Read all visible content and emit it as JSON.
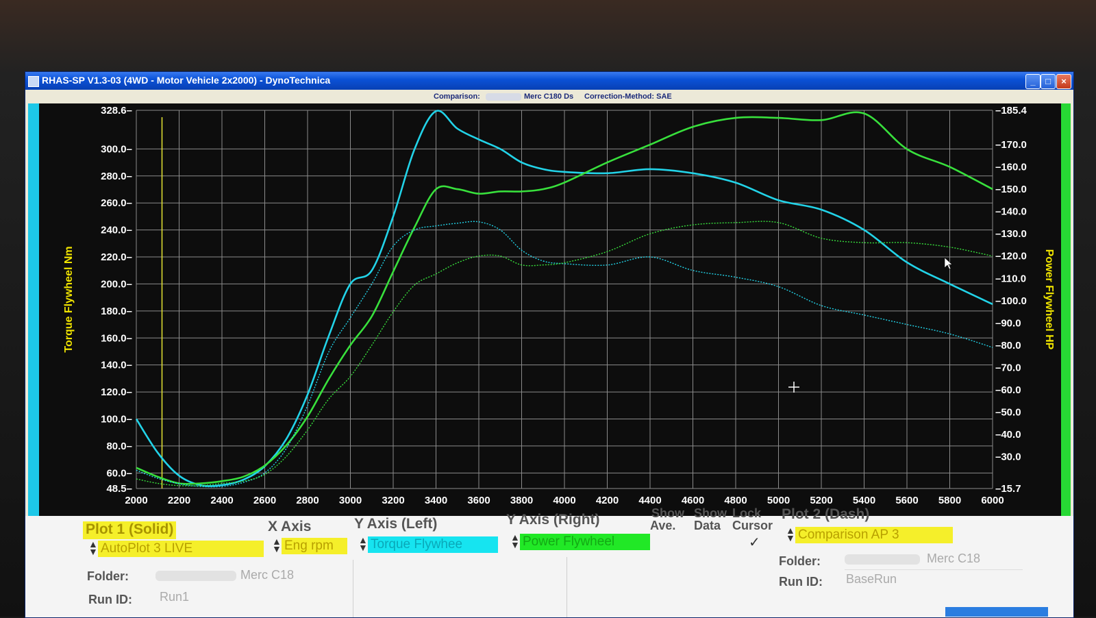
{
  "window": {
    "title": "RHAS-SP V1.3-03  (4WD - Motor Vehicle 2x2000) - DynoTechnica",
    "buttons": {
      "minimize": "_",
      "maximize": "□",
      "close": "×"
    }
  },
  "info_bar": {
    "comparison_label": "Comparison:",
    "vehicle": "Merc C180 Ds",
    "correction": "Correction-Method: SAE"
  },
  "colors": {
    "plot_background": "#0d0d0d",
    "grid": "#8c8c8c",
    "torque": "#22d3e8",
    "power": "#38e03c",
    "cursor": "#e6e632",
    "axis_text": "#ffffff",
    "axis_title": "#f0e400"
  },
  "chart_data": {
    "type": "line",
    "x_label": "",
    "y_left_label": "Torque Flywheel Nm",
    "y_right_label": "Power Flywheel HP",
    "xlim": [
      2000,
      6000
    ],
    "ylim_left": [
      48.5,
      328.6
    ],
    "ylim_right": [
      15.7,
      185.4
    ],
    "x_ticks": [
      "2000",
      "2200",
      "2400",
      "2600",
      "2800",
      "3000",
      "3200",
      "3400",
      "3600",
      "3800",
      "4000",
      "4200",
      "4400",
      "4600",
      "4800",
      "5000",
      "5200",
      "5400",
      "5600",
      "5800",
      "6000"
    ],
    "y_left_ticks": [
      "328.6",
      "300.0",
      "280.0",
      "260.0",
      "240.0",
      "220.0",
      "200.0",
      "180.0",
      "160.0",
      "140.0",
      "120.0",
      "100.0",
      "80.0",
      "60.0",
      "48.5"
    ],
    "y_right_ticks": [
      "185.4",
      "170.0",
      "160.0",
      "150.0",
      "140.0",
      "130.0",
      "120.0",
      "110.0",
      "100.0",
      "90.0",
      "80.0",
      "70.0",
      "60.0",
      "50.0",
      "40.0",
      "30.0",
      "15.7"
    ],
    "grid": true,
    "cursor_line_x": 2120,
    "series": [
      {
        "name": "AutoPlot 3 LIVE - Torque Flywheel",
        "axis": "left",
        "style": "solid",
        "color": "#22d3e8",
        "x": [
          2000,
          2100,
          2200,
          2300,
          2400,
          2500,
          2600,
          2700,
          2800,
          2900,
          3000,
          3100,
          3200,
          3300,
          3400,
          3500,
          3600,
          3700,
          3800,
          3900,
          4000,
          4200,
          4400,
          4600,
          4800,
          5000,
          5200,
          5400,
          5600,
          5800,
          6000
        ],
        "y": [
          100,
          75,
          58,
          51,
          51,
          55,
          65,
          85,
          118,
          162,
          200,
          210,
          250,
          300,
          328,
          315,
          307,
          300,
          290,
          285,
          283,
          282,
          285,
          282,
          275,
          262,
          255,
          240,
          216,
          200,
          185
        ]
      },
      {
        "name": "AutoPlot 3 LIVE - Power Flywheel",
        "axis": "right",
        "style": "solid",
        "color": "#38e03c",
        "x": [
          2000,
          2100,
          2200,
          2300,
          2400,
          2500,
          2600,
          2700,
          2800,
          2900,
          3000,
          3100,
          3200,
          3300,
          3400,
          3500,
          3600,
          3700,
          3800,
          3900,
          4000,
          4200,
          4400,
          4600,
          4800,
          5000,
          5200,
          5400,
          5600,
          5800,
          6000
        ],
        "y": [
          25,
          21,
          18,
          18,
          19,
          21,
          26,
          35,
          48,
          65,
          80,
          93,
          113,
          133,
          150,
          150,
          148,
          149,
          149,
          150,
          153,
          162,
          170,
          178,
          182,
          182,
          181,
          184,
          168,
          160,
          150
        ]
      },
      {
        "name": "Comparison AP 3 - Torque Flywheel",
        "axis": "left",
        "style": "dash",
        "color": "#22d3e8",
        "x": [
          2000,
          2100,
          2200,
          2300,
          2400,
          2500,
          2600,
          2700,
          2800,
          2900,
          3000,
          3100,
          3200,
          3300,
          3400,
          3500,
          3600,
          3700,
          3800,
          3900,
          4000,
          4200,
          4400,
          4600,
          4800,
          5000,
          5200,
          5400,
          5600,
          5800,
          6000
        ],
        "y": [
          62,
          56,
          52,
          50,
          50,
          53,
          60,
          78,
          110,
          150,
          175,
          200,
          228,
          240,
          243,
          245,
          246,
          240,
          225,
          217,
          215,
          214,
          220,
          210,
          205,
          198,
          184,
          177,
          170,
          163,
          153
        ]
      },
      {
        "name": "Comparison AP 3 - Power Flywheel",
        "axis": "right",
        "style": "dash",
        "color": "#38e03c",
        "x": [
          2000,
          2100,
          2200,
          2300,
          2400,
          2500,
          2600,
          2700,
          2800,
          2900,
          3000,
          3100,
          3200,
          3300,
          3400,
          3500,
          3600,
          3700,
          3800,
          3900,
          4000,
          4200,
          4400,
          4600,
          4800,
          5000,
          5200,
          5400,
          5600,
          5800,
          6000
        ],
        "y": [
          20,
          18,
          17,
          17,
          18,
          19,
          22,
          30,
          42,
          56,
          66,
          80,
          95,
          107,
          112,
          117,
          120,
          120,
          116,
          116,
          117,
          122,
          130,
          134,
          135,
          135,
          128,
          126,
          126,
          124,
          120
        ]
      }
    ]
  },
  "plot1": {
    "title": "Plot 1 (Solid)",
    "source": "AutoPlot 3 LIVE",
    "folder_label": "Folder:",
    "folder_value": "Merc C18",
    "runid_label": "Run ID:",
    "runid_value": "Run1"
  },
  "x_axis": {
    "title": "X Axis",
    "value": "Eng rpm"
  },
  "y_axis_left": {
    "title": "Y Axis (Left)",
    "value": "Torque Flywhee"
  },
  "y_axis_right": {
    "title": "Y Axis (Right)",
    "value": "Power Flywheel"
  },
  "options": {
    "show_ave_line1": "Show",
    "show_ave_line2": "Ave.",
    "show_data_line1": "Show",
    "show_data_line2": "Data",
    "lock_cursor_line1": "Lock",
    "lock_cursor_line2": "Cursor",
    "lock_cursor_checked": "✓"
  },
  "plot2": {
    "title": "Plot 2 (Dash)",
    "source": "Comparison AP 3",
    "folder_label": "Folder:",
    "folder_value": "Merc C18",
    "runid_label": "Run ID:",
    "runid_value": "BaseRun"
  }
}
